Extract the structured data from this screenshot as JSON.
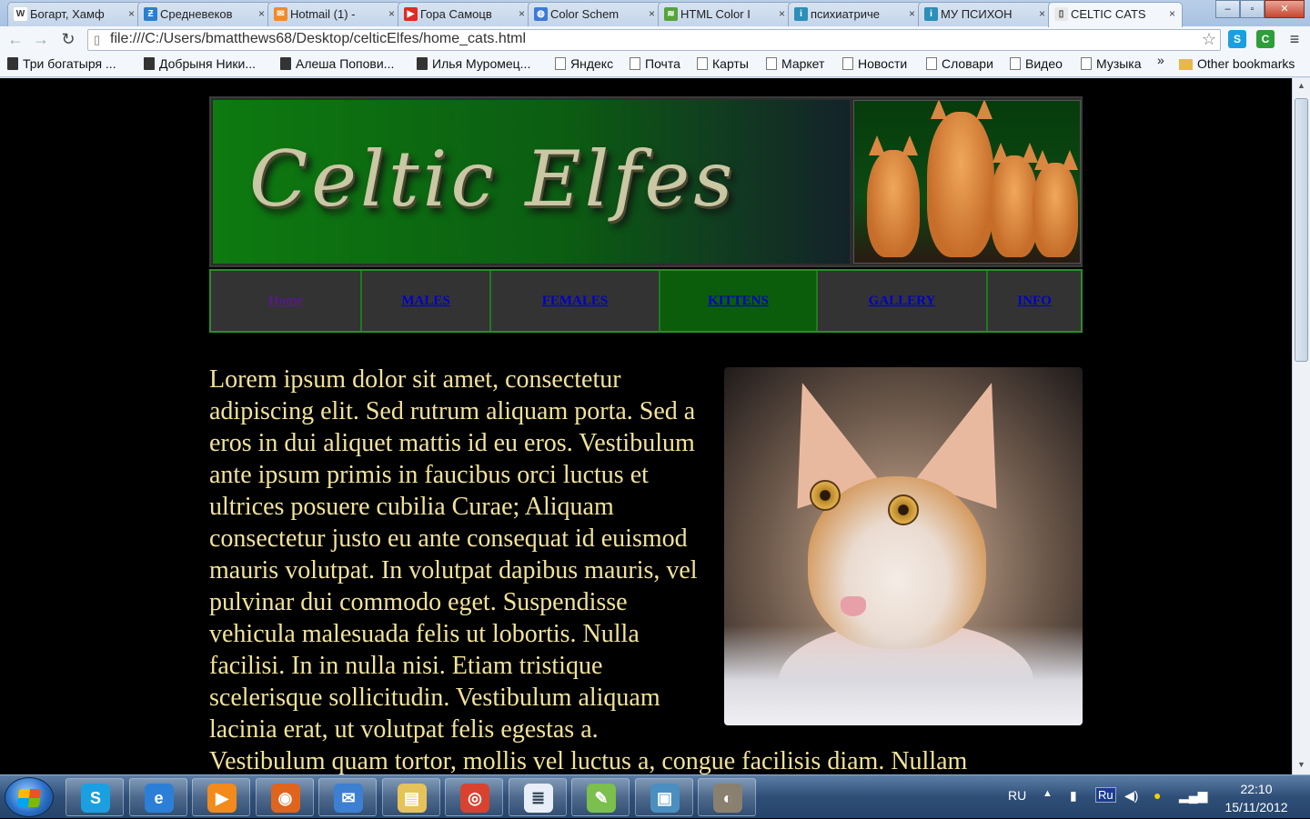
{
  "browser": {
    "tabs": [
      {
        "favicon": "W",
        "favicon_color": "#ffffff",
        "label": "Богарт, Хамф"
      },
      {
        "favicon": "Ƶ",
        "favicon_color": "#2a7fd0",
        "label": "Средневеков"
      },
      {
        "favicon": "✉",
        "favicon_color": "#f08c28",
        "label": "Hotmail (1) - "
      },
      {
        "favicon": "▶",
        "favicon_color": "#e02b20",
        "label": "Гора Самоцв"
      },
      {
        "favicon": "◍",
        "favicon_color": "#3b7ad8",
        "label": "Color Schem"
      },
      {
        "favicon": "≋",
        "favicon_color": "#57a33a",
        "label": "HTML Color I"
      },
      {
        "favicon": "i",
        "favicon_color": "#2b8fb8",
        "label": "психиатриче"
      },
      {
        "favicon": "i",
        "favicon_color": "#2b8fb8",
        "label": "МУ ПСИХОН"
      },
      {
        "favicon": "▯",
        "favicon_color": "#e8e8e8",
        "label": "CELTIC CATS"
      }
    ],
    "active_tab_index": 8,
    "tab_close_glyph": "×",
    "window_controls": {
      "minimize": "–",
      "maximize": "▫",
      "close": "✕"
    },
    "nav": {
      "back": "←",
      "forward": "→",
      "reload": "↻"
    },
    "url": "file:///C:/Users/bmatthews68/Desktop/celticElfes/home_cats.html",
    "star_icon": "☆",
    "menu_icon": "≡",
    "extensions": [
      {
        "name": "skype-extension-icon",
        "glyph": "S",
        "color": "#1aa0e0"
      },
      {
        "name": "evernote-extension-icon",
        "glyph": "C",
        "color": "#2e9e3a"
      }
    ],
    "bookmarks": [
      {
        "label": "Три богатыря ...",
        "icon": "film"
      },
      {
        "label": "Добрыня Ники...",
        "icon": "film"
      },
      {
        "label": "Алеша Попови...",
        "icon": "film"
      },
      {
        "label": "Илья Муромец...",
        "icon": "film"
      },
      {
        "label": "Яндекс",
        "icon": "doc"
      },
      {
        "label": "Почта",
        "icon": "doc"
      },
      {
        "label": "Карты",
        "icon": "doc"
      },
      {
        "label": "Маркет",
        "icon": "doc"
      },
      {
        "label": "Новости",
        "icon": "doc"
      },
      {
        "label": "Словари",
        "icon": "doc"
      },
      {
        "label": "Видео",
        "icon": "doc"
      },
      {
        "label": "Музыка",
        "icon": "doc"
      }
    ],
    "bookmarks_overflow": "»",
    "other_bookmarks": "Other bookmarks"
  },
  "page": {
    "logo_text": "Celtic Elfes",
    "nav_links": [
      {
        "label": "Home",
        "state": "current"
      },
      {
        "label": "MALES",
        "state": "normal"
      },
      {
        "label": "FEMALES",
        "state": "normal"
      },
      {
        "label": "KITTENS",
        "state": "highlighted"
      },
      {
        "label": "GALLERY",
        "state": "normal"
      },
      {
        "label": "INFO",
        "state": "normal"
      }
    ],
    "body_text": "Lorem ipsum dolor sit amet, consectetur adipiscing elit. Sed rutrum aliquam porta. Sed a eros in dui aliquet mattis id eu eros. Vestibulum ante ipsum primis in faucibus orci luctus et ultrices posuere cubilia Curae; Aliquam consectetur justo eu ante consequat id euismod mauris volutpat. In volutpat dapibus mauris, vel pulvinar dui commodo eget. Suspendisse vehicula malesuada felis ut lobortis. Nulla facilisi. In in nulla nisi. Etiam tristique scelerisque sollicitudin. Vestibulum aliquam lacinia erat, ut volutpat felis egestas a. Vestibulum quam tortor, mollis vel luctus a, congue facilisis diam. Nullam",
    "colors": {
      "background": "#000000",
      "text": "#f2e39a",
      "accent_green": "#0b5d0b",
      "link": "#0000cc",
      "visited": "#551a8b"
    }
  },
  "taskbar": {
    "apps": [
      {
        "name": "skype-taskbar-icon",
        "glyph": "S",
        "color": "#1aa0e0"
      },
      {
        "name": "internet-explorer-taskbar-icon",
        "glyph": "e",
        "color": "#2c7fd6"
      },
      {
        "name": "media-player-taskbar-icon",
        "glyph": "▶",
        "color": "#f28a1c"
      },
      {
        "name": "firefox-taskbar-icon",
        "glyph": "◉",
        "color": "#e0641c"
      },
      {
        "name": "mail-taskbar-icon",
        "glyph": "✉",
        "color": "#3d7fd1"
      },
      {
        "name": "explorer-taskbar-icon",
        "glyph": "▤",
        "color": "#e6c35a"
      },
      {
        "name": "chrome-taskbar-icon",
        "glyph": "◎",
        "color": "#d8432f"
      },
      {
        "name": "notepad-taskbar-icon",
        "glyph": "≣",
        "color": "#e8eef8"
      },
      {
        "name": "editor-taskbar-icon",
        "glyph": "✎",
        "color": "#7bbf4c"
      },
      {
        "name": "image-viewer-taskbar-icon",
        "glyph": "▣",
        "color": "#4a8fc0"
      },
      {
        "name": "gimp-taskbar-icon",
        "glyph": "◐",
        "color": "#8a8070"
      }
    ],
    "language": "RU",
    "keyboard_layout": "Ru",
    "time": "22:10",
    "date": "15/11/2012"
  }
}
